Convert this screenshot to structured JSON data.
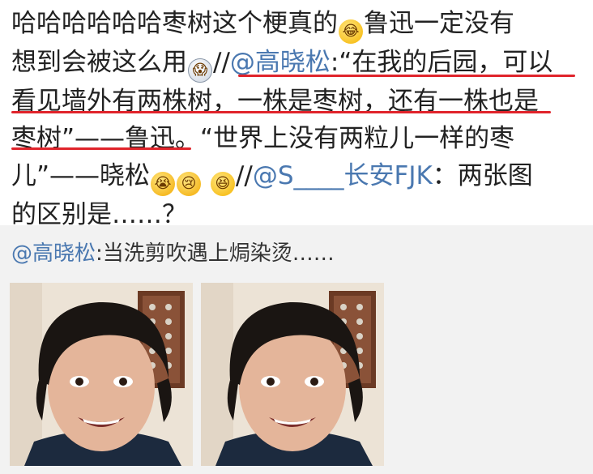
{
  "post": {
    "line1_text": "哈哈哈哈哈哈枣树这个梗真的",
    "line1_after_emoji": "鲁迅一定没有",
    "line2_text": "想到会被这么用",
    "line2_slashes": "//",
    "mention1": "@高晓松",
    "line2_quote": ":“在我的后园，可以",
    "line3_text": "看见墙外有两株树，一株是枣树，还有一株也是",
    "line4_text": "枣树”——鲁迅。“世界上没有两粒儿一样的枣",
    "line5_text": "儿”——晓松",
    "line5_slashes": "//",
    "mention2": "@S____长安FJK",
    "line5_tail": "：两张图",
    "line6_text": "的区别是……？"
  },
  "repost": {
    "mention": "@高晓松",
    "text": ":当洗剪吹遇上焗染烫……"
  },
  "emojis": {
    "laugh": "laughing-tears-emoji",
    "surprise": "surprised-emoji",
    "cry": "crying-emoji",
    "tears": "tears-emoji",
    "grin": "grinning-emoji"
  },
  "colors": {
    "link": "#4a78b0",
    "underline": "#e0242b",
    "repost_bg": "#f2f2f2"
  }
}
